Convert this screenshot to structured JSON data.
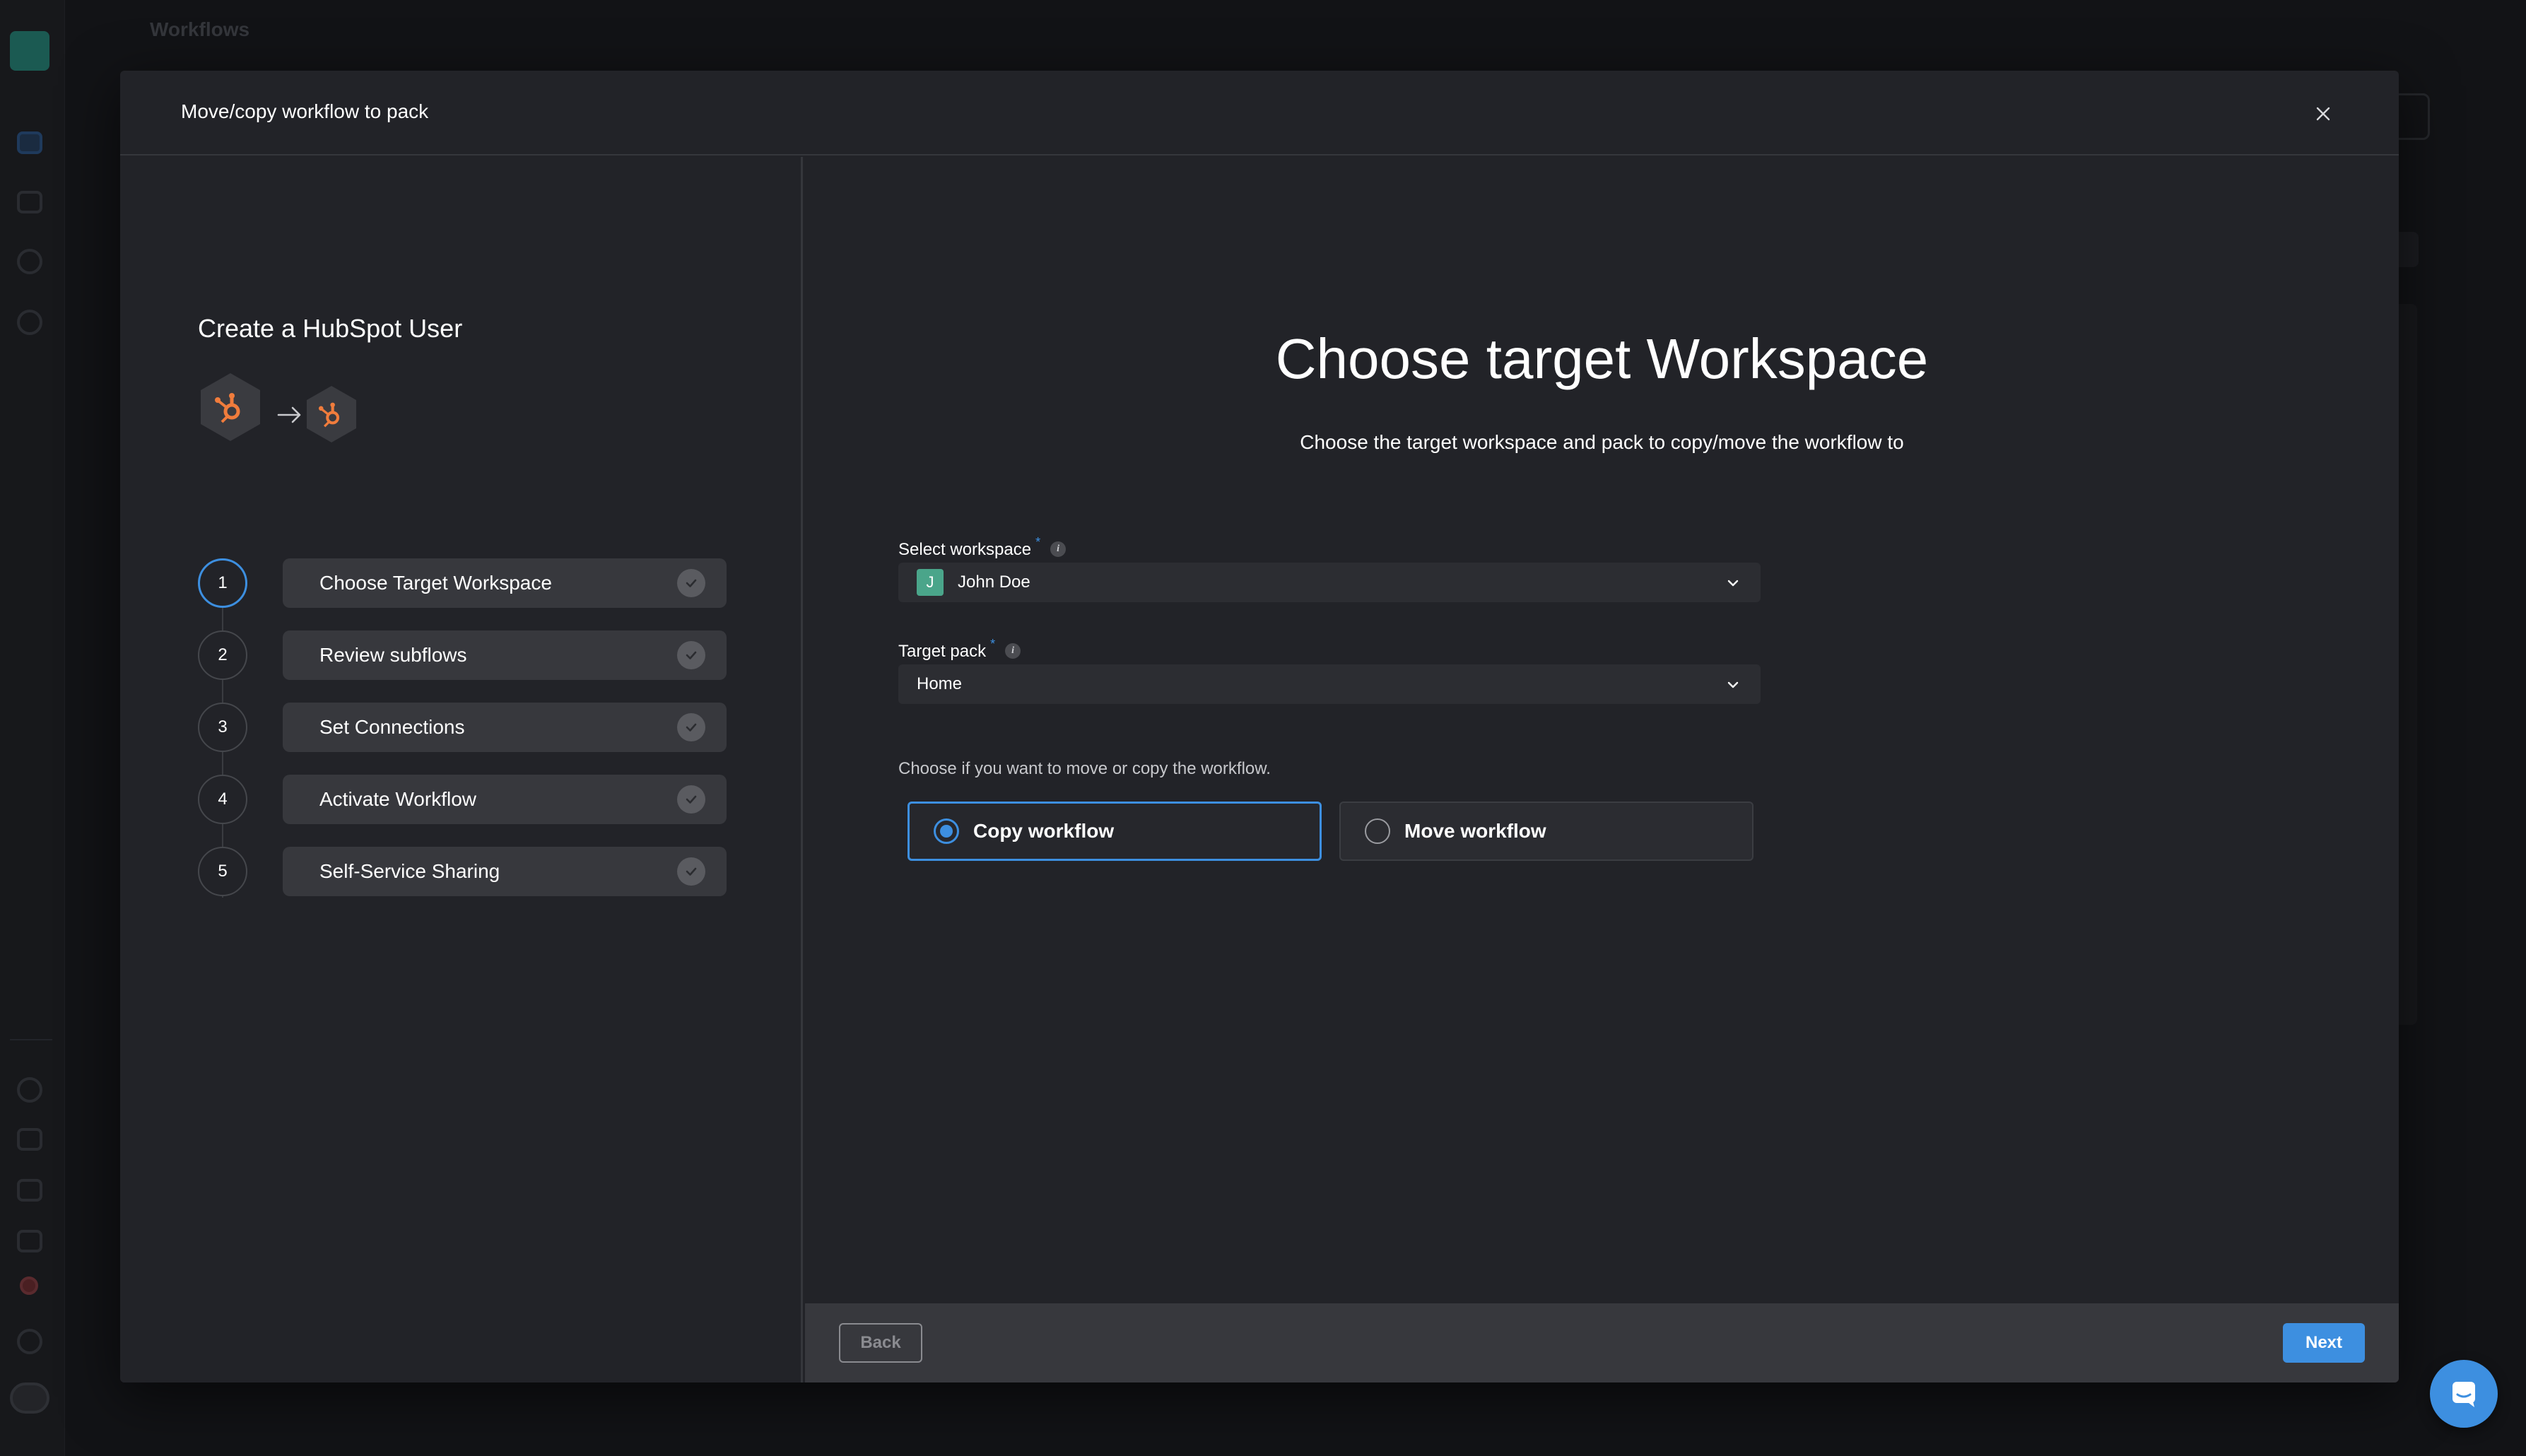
{
  "background": {
    "page_title": "Workflows"
  },
  "modal": {
    "title": "Move/copy workflow to pack",
    "workflow_name": "Create a HubSpot User",
    "connector_icons": [
      "hubspot-icon",
      "arrow-right-icon",
      "hubspot-icon"
    ],
    "steps": [
      {
        "number": "1",
        "label": "Choose Target Workspace",
        "active": true
      },
      {
        "number": "2",
        "label": "Review subflows",
        "active": false
      },
      {
        "number": "3",
        "label": "Set Connections",
        "active": false
      },
      {
        "number": "4",
        "label": "Activate Workflow",
        "active": false
      },
      {
        "number": "5",
        "label": "Self-Service Sharing",
        "active": false
      }
    ],
    "main": {
      "title": "Choose target Workspace",
      "subtitle": "Choose the target workspace and pack to copy/move the workflow to",
      "workspace_label": "Select workspace",
      "workspace_value": "John Doe",
      "workspace_initial": "J",
      "pack_label": "Target pack",
      "pack_value": "Home",
      "required_mark": "*",
      "info_mark": "i",
      "radio_hint": "Choose if you want to move or copy the workflow.",
      "options": [
        {
          "label": "Copy workflow",
          "selected": true
        },
        {
          "label": "Move workflow",
          "selected": false
        }
      ]
    },
    "footer": {
      "back_label": "Back",
      "next_label": "Next"
    }
  },
  "colors": {
    "accent": "#3d8fe0",
    "hubspot_orange": "#f07c3c",
    "workspace_avatar": "#4aa58a"
  }
}
